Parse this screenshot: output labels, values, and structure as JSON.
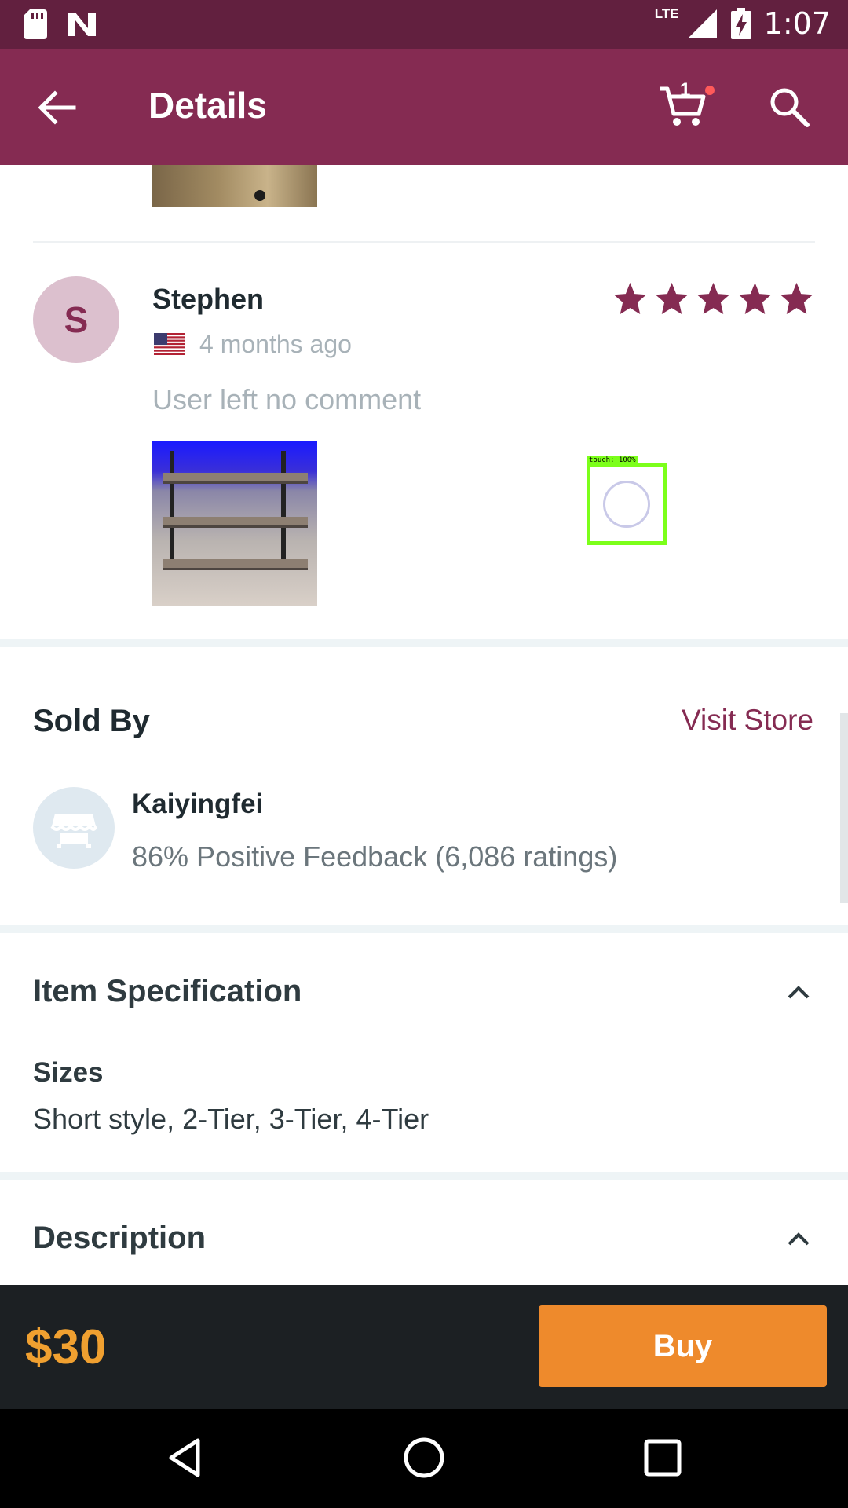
{
  "status_bar": {
    "time": "1:07",
    "network": "LTE",
    "icons": [
      "sd-card-icon",
      "n-notification-icon",
      "signal-icon",
      "battery-charging-icon"
    ]
  },
  "app_bar": {
    "title": "Details",
    "cart_count": "1",
    "icons": [
      "back-arrow-icon",
      "cart-icon",
      "search-icon"
    ]
  },
  "review": {
    "avatar_initial": "S",
    "name": "Stephen",
    "time": "4 months ago",
    "rating": 5,
    "rating_max": 5,
    "comment": "User left no comment",
    "country_flag": "us-flag-icon"
  },
  "overlay": {
    "touch_label": "touch: 100%"
  },
  "seller": {
    "section_title": "Sold By",
    "visit_store_label": "Visit Store",
    "store_name": "Kaiyingfei",
    "feedback": "86% Positive Feedback (6,086 ratings)"
  },
  "specification": {
    "section_title": "Item Specification",
    "sizes_label": "Sizes",
    "sizes_value": "Short style, 2-Tier, 3-Tier, 4-Tier"
  },
  "description": {
    "section_title": "Description"
  },
  "purchase": {
    "price": "$30",
    "buy_label": "Buy"
  },
  "colors": {
    "status_bar": "#62203f",
    "app_bar": "#852b52",
    "accent": "#852b52",
    "buy_button": "#ee8a2c",
    "price": "#f0a030"
  }
}
